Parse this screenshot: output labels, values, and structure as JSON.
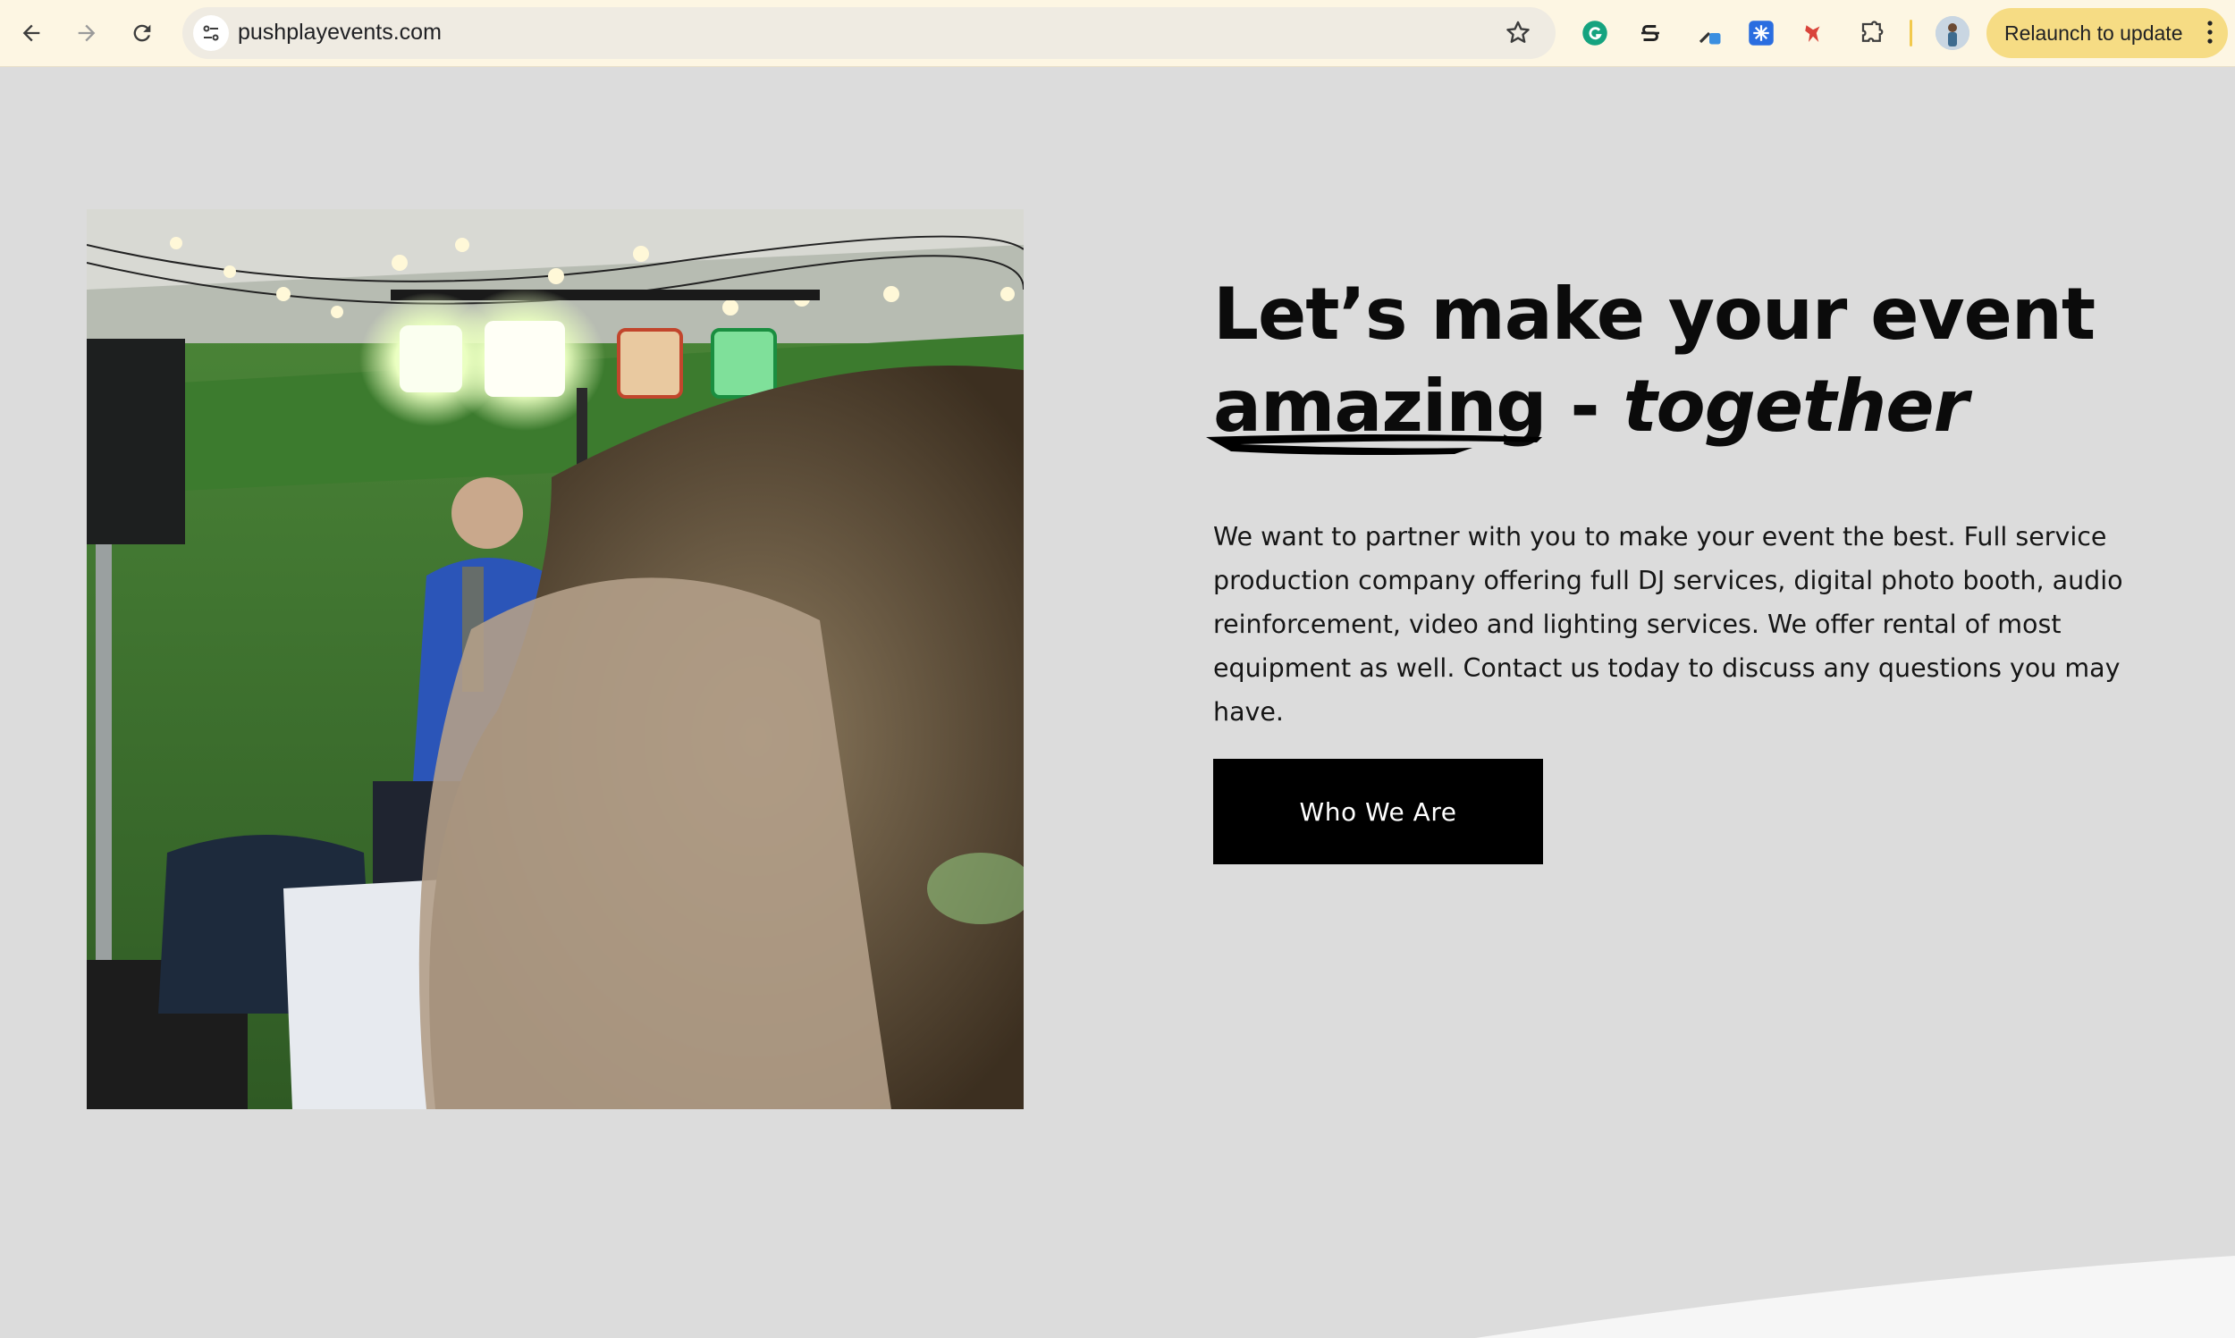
{
  "browser": {
    "url": "pushplayevents.com",
    "relaunch_label": "Relaunch to update"
  },
  "hero": {
    "headline_part1": "Let’s make your event",
    "headline_amazing": "amazing",
    "headline_dash": " - ",
    "headline_together": "together",
    "body": "We want to partner with you to make your event the best. Full service production company offering full DJ services, digital photo booth, audio reinforcement, video and lighting services. We offer rental of most equipment as well. Contact us today to discuss any questions you may have.",
    "cta_label": "Who We Are"
  },
  "colors": {
    "page_background": "#dcdcdc",
    "cta_background": "#000000",
    "relaunch_background": "#f6dc84"
  }
}
